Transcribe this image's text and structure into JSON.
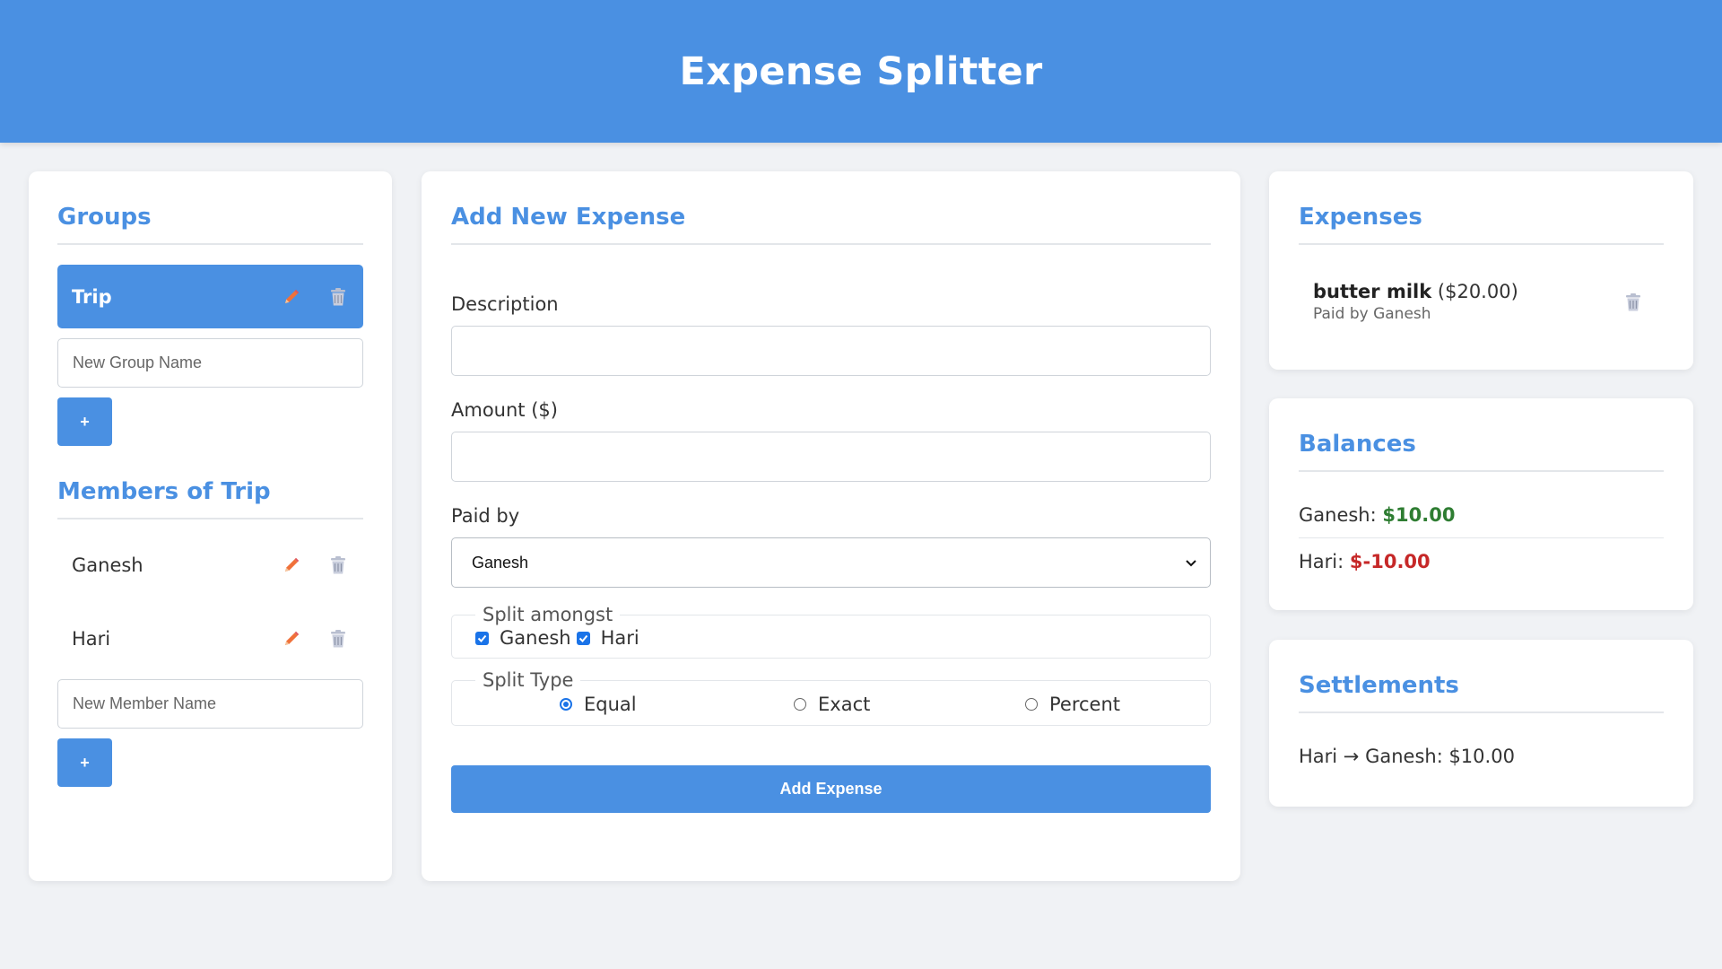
{
  "header": {
    "title": "Expense Splitter"
  },
  "groups": {
    "title": "Groups",
    "items": [
      {
        "name": "Trip"
      }
    ],
    "new_group_placeholder": "New Group Name",
    "add_label": "+"
  },
  "members": {
    "title": "Members of Trip",
    "items": [
      {
        "name": "Ganesh"
      },
      {
        "name": "Hari"
      }
    ],
    "new_member_placeholder": "New Member Name",
    "add_label": "+"
  },
  "expense_form": {
    "title": "Add New Expense",
    "description_label": "Description",
    "description_value": "",
    "amount_label": "Amount ($)",
    "amount_value": "",
    "paid_by_label": "Paid by",
    "paid_by_selected": "Ganesh",
    "split_amongst_legend": "Split amongst",
    "split_amongst": [
      {
        "name": "Ganesh",
        "checked": true
      },
      {
        "name": "Hari",
        "checked": true
      }
    ],
    "split_type_legend": "Split Type",
    "split_types": [
      {
        "label": "Equal",
        "selected": true
      },
      {
        "label": "Exact",
        "selected": false
      },
      {
        "label": "Percent",
        "selected": false
      }
    ],
    "submit_label": "Add Expense"
  },
  "expenses": {
    "title": "Expenses",
    "items": [
      {
        "description": "butter milk",
        "amount": "($20.00)",
        "paid_by": "Paid by Ganesh"
      }
    ]
  },
  "balances": {
    "title": "Balances",
    "items": [
      {
        "name": "Ganesh:",
        "amount": "$10.00",
        "status": "positive"
      },
      {
        "name": "Hari:",
        "amount": "$-10.00",
        "status": "negative"
      }
    ]
  },
  "settlements": {
    "title": "Settlements",
    "items": [
      {
        "text": "Hari → Ganesh: $10.00"
      }
    ]
  },
  "colors": {
    "primary": "#4a90e2",
    "background": "#f0f2f5",
    "positive": "#2e7d32",
    "negative": "#c62828",
    "edit_icon": "#f0713a",
    "delete_icon": "#9aa0b4"
  },
  "icons": {
    "edit": "pencil-icon",
    "delete": "trash-icon",
    "select": "chevron-down-icon"
  }
}
